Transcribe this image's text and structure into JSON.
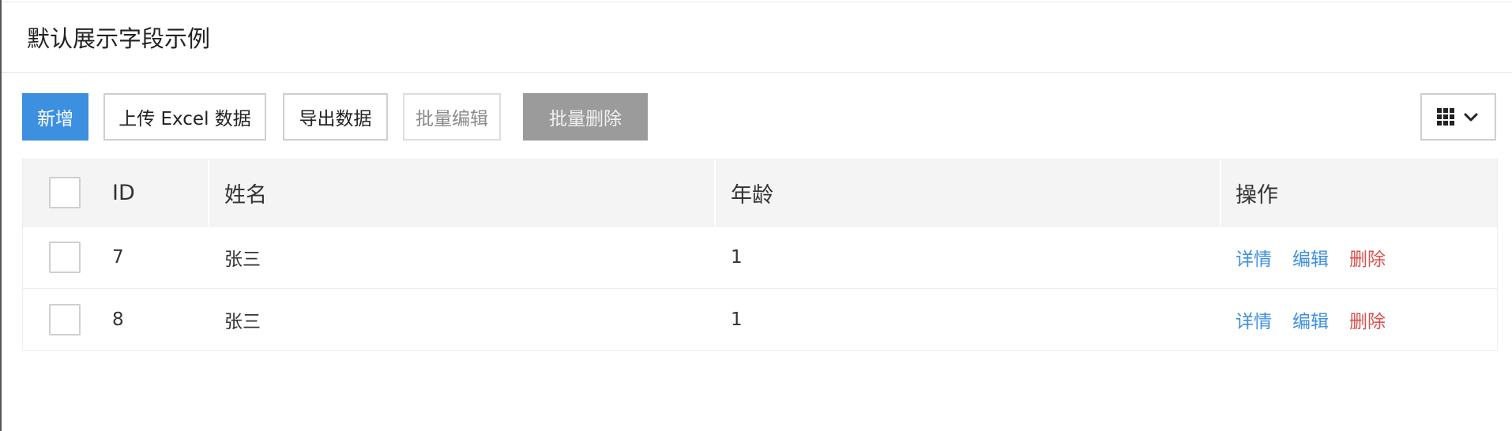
{
  "panel": {
    "title": "默认展示字段示例"
  },
  "toolbar": {
    "add_label": "新增",
    "upload_label": "上传 Excel 数据",
    "export_label": "导出数据",
    "batch_edit_label": "批量编辑",
    "batch_delete_label": "批量删除",
    "columns_icon": "grid-icon",
    "columns_dropdown_icon": "chevron-down-icon"
  },
  "table": {
    "columns": [
      "ID",
      "姓名",
      "年龄",
      "操作"
    ],
    "rows": [
      {
        "id": "7",
        "name": "张三",
        "age": "1",
        "actions": [
          "详情",
          "编辑",
          "删除"
        ]
      },
      {
        "id": "8",
        "name": "张三",
        "age": "1",
        "actions": [
          "详情",
          "编辑",
          "删除"
        ]
      }
    ]
  },
  "colors": {
    "primary": "#3d8fe0",
    "danger": "#d9534f",
    "disabled_fill": "#9b9b9b",
    "header_bg": "#f4f4f4"
  }
}
